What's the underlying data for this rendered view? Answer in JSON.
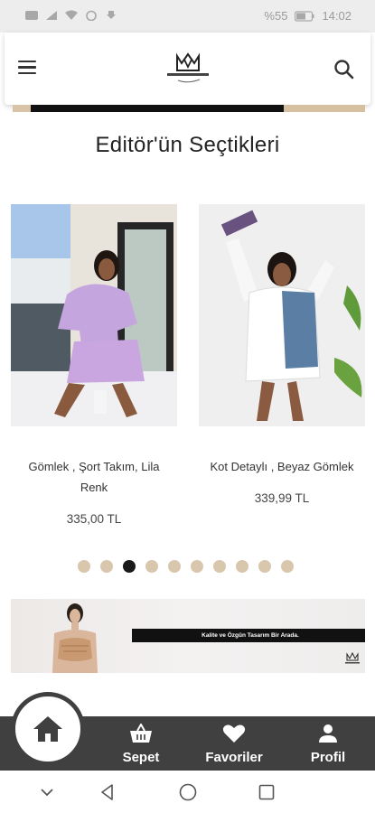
{
  "statusbar": {
    "battery": "%55",
    "time": "14:02"
  },
  "header": {
    "logo_alt": "brand-logo"
  },
  "section": {
    "title": "Editör'ün Seçtikleri"
  },
  "products": [
    {
      "name": "Gömlek , Şort Takım, Lila Renk",
      "price": "335,00 TL"
    },
    {
      "name": "Kot Detaylı , Beyaz Gömlek",
      "price": "339,99 TL"
    }
  ],
  "carousel": {
    "count": 10,
    "active_index": 2
  },
  "promo": {
    "text": "Kalite ve Özgün Tasarım Bir Arada."
  },
  "bottom_nav": {
    "items": [
      {
        "label": "Sepet",
        "icon": "basket-icon"
      },
      {
        "label": "Favoriler",
        "icon": "heart-icon"
      },
      {
        "label": "Profil",
        "icon": "person-icon"
      }
    ],
    "home_icon": "home-icon"
  },
  "colors": {
    "dot_inactive": "#d9c7ad",
    "dot_active": "#1a1a1a",
    "nav_bg": "#404040"
  }
}
